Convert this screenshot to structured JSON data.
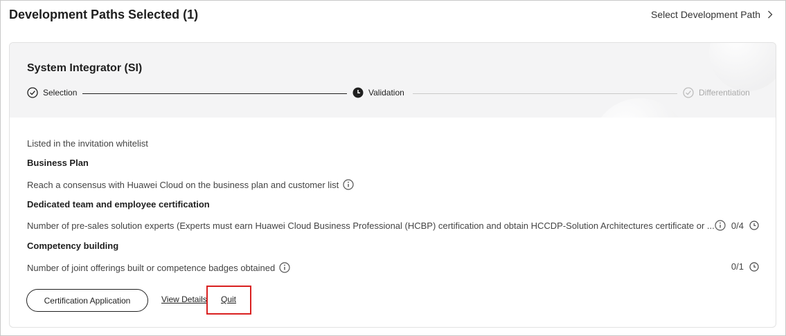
{
  "header": {
    "title": "Development Paths Selected (1)",
    "select_path_label": "Select Development Path"
  },
  "card": {
    "path_name": "System Integrator (SI)",
    "steps": [
      {
        "label": "Selection",
        "state": "completed"
      },
      {
        "label": "Validation",
        "state": "current"
      },
      {
        "label": "Differentiation",
        "state": "pending"
      }
    ],
    "intro": "Listed in the invitation whitelist",
    "sections": [
      {
        "heading": "Business Plan",
        "item": "Reach a consensus with Huawei Cloud on the business plan and customer list",
        "progress": ""
      },
      {
        "heading": "Dedicated team and employee certification",
        "item": "Number of pre-sales solution experts (Experts must earn Huawei Cloud Business Professional (HCBP) certification and obtain HCCDP-Solution Architectures certificate or ...",
        "progress": "0/4"
      },
      {
        "heading": "Competency building",
        "item": "Number of joint offerings built or competence badges obtained",
        "progress": "0/1"
      }
    ],
    "actions": {
      "certification_label": "Certification Application",
      "view_details_label": "View Details",
      "quit_label": "Quit"
    }
  },
  "colors": {
    "highlight": "#d92020",
    "pending": "#aaaaaa",
    "text": "#1f1f1f"
  }
}
